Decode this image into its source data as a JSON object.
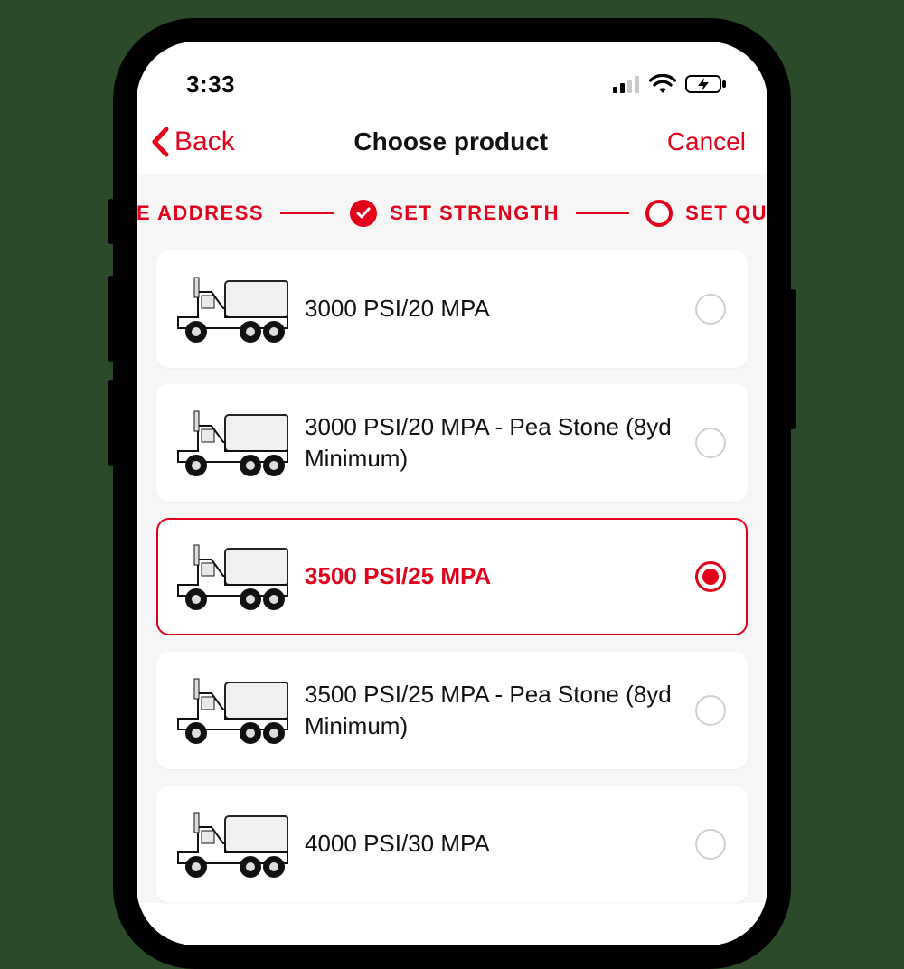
{
  "status": {
    "time": "3:33"
  },
  "nav": {
    "back": "Back",
    "title": "Choose product",
    "cancel": "Cancel"
  },
  "stepper": {
    "prev_partial": "E ADDRESS",
    "current": "SET STRENGTH",
    "next_partial": "SET QU"
  },
  "products": [
    {
      "label": "3000 PSI/20 MPA",
      "selected": false
    },
    {
      "label": "3000 PSI/20 MPA - Pea Stone (8yd Minimum)",
      "selected": false
    },
    {
      "label": "3500 PSI/25 MPA",
      "selected": true
    },
    {
      "label": "3500 PSI/25 MPA - Pea Stone (8yd Minimum)",
      "selected": false
    },
    {
      "label": "4000 PSI/30 MPA",
      "selected": false
    }
  ],
  "accent": "#e2001a"
}
